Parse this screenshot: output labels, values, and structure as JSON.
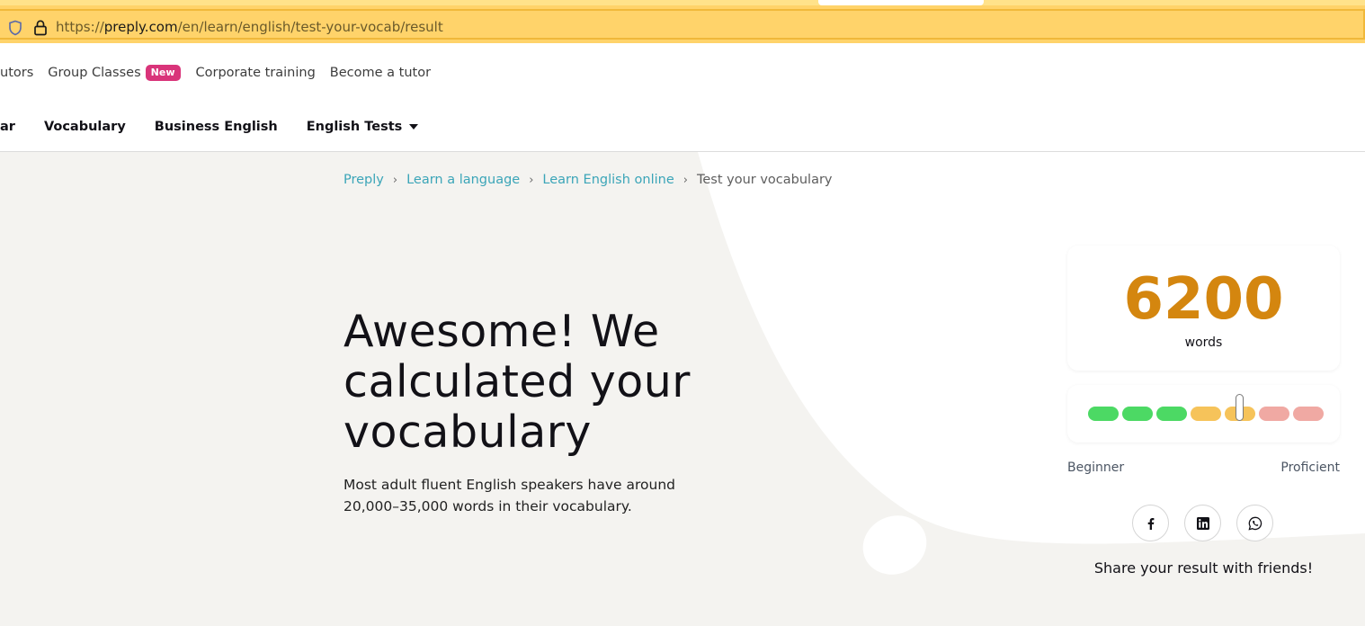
{
  "browser": {
    "url_scheme": "https://",
    "url_host": "preply.com",
    "url_path": "/en/learn/english/test-your-vocab/result"
  },
  "topnav": {
    "find_tutors": "utors",
    "group_classes": "Group Classes",
    "new_badge": "New",
    "corporate_training": "Corporate training",
    "become_tutor": "Become a tutor"
  },
  "subnav": {
    "grammar": "ar",
    "vocabulary": "Vocabulary",
    "business_english": "Business English",
    "english_tests": "English Tests"
  },
  "breadcrumb": {
    "items": [
      "Preply",
      "Learn a language",
      "Learn English online"
    ],
    "current": "Test your vocabulary",
    "separator": "›"
  },
  "hero": {
    "headline": "Awesome! We calculated your vocabulary",
    "lead": "Most adult fluent English speakers have around 20,000–35,000 words in their vocabulary."
  },
  "result": {
    "count": "6200",
    "unit": "words",
    "level_fraction": 0.64,
    "segments": [
      "green",
      "green",
      "green",
      "yellow",
      "yellow",
      "red",
      "red"
    ],
    "scale_min_label": "Beginner",
    "scale_max_label": "Proficient"
  },
  "share": {
    "text": "Share your result with friends!",
    "networks": [
      "facebook-icon",
      "linkedin-icon",
      "whatsapp-icon"
    ]
  },
  "colors": {
    "accent_score": "#d4860f",
    "link": "#3ba5b8",
    "badge": "#d9347a",
    "green": "#4cd964",
    "yellow": "#f6c35a",
    "red": "#f0a9a3"
  }
}
